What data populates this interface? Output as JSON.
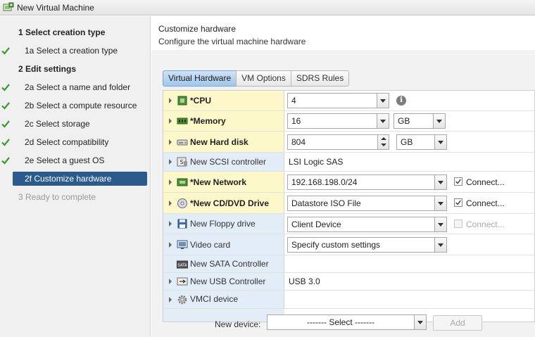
{
  "window": {
    "title": "New Virtual Machine"
  },
  "wizard": {
    "steps": [
      {
        "label": "1  Select creation type",
        "type": "header",
        "checked": false
      },
      {
        "label": "1a  Select a creation type",
        "type": "sub",
        "checked": true
      },
      {
        "label": "2  Edit settings",
        "type": "header",
        "checked": false
      },
      {
        "label": "2a  Select a name and folder",
        "type": "sub",
        "checked": true
      },
      {
        "label": "2b  Select a compute resource",
        "type": "sub",
        "checked": true
      },
      {
        "label": "2c  Select storage",
        "type": "sub",
        "checked": true
      },
      {
        "label": "2d  Select compatibility",
        "type": "sub",
        "checked": true
      },
      {
        "label": "2e  Select a guest OS",
        "type": "sub",
        "checked": true
      },
      {
        "label": "2f  Customize hardware",
        "type": "sub",
        "selected": true
      },
      {
        "label": "3  Ready to complete",
        "type": "header",
        "disabled": true
      }
    ]
  },
  "header": {
    "title": "Customize hardware",
    "subtitle": "Configure the virtual machine hardware"
  },
  "tabs": [
    {
      "label": "Virtual Hardware",
      "active": true
    },
    {
      "label": "VM Options",
      "active": false
    },
    {
      "label": "SDRS Rules",
      "active": false
    }
  ],
  "hardware": {
    "cpu": {
      "name": "*CPU",
      "value": "4"
    },
    "memory": {
      "name": "*Memory",
      "value": "16",
      "unit": "GB"
    },
    "hard_disk": {
      "name": "New Hard disk",
      "value": "804",
      "unit": "GB"
    },
    "scsi": {
      "name": "New SCSI controller",
      "value": "LSI Logic SAS"
    },
    "network": {
      "name": "*New Network",
      "value": "192.168.198.0/24",
      "connect_label": "Connect...",
      "connected": true
    },
    "cdrom": {
      "name": "*New CD/DVD Drive",
      "value": "Datastore ISO File",
      "connect_label": "Connect...",
      "connected": true
    },
    "floppy": {
      "name": "New Floppy drive",
      "value": "Client Device",
      "connect_label": "Connect...",
      "connected": false
    },
    "video": {
      "name": "Video card",
      "value": "Specify custom settings"
    },
    "sata": {
      "name": "New SATA Controller"
    },
    "usb": {
      "name": "New USB Controller",
      "value": "USB 3.0"
    },
    "vmci": {
      "name": "VMCI device"
    }
  },
  "new_device": {
    "label": "New device:",
    "select_value": "------- Select -------",
    "add_label": "Add"
  },
  "colors": {
    "selected_step": "#2b5b8c",
    "check_green": "#3a9a2e",
    "new_row_bg": "#fdf8c9",
    "name_col_bg": "#e3edf7"
  }
}
